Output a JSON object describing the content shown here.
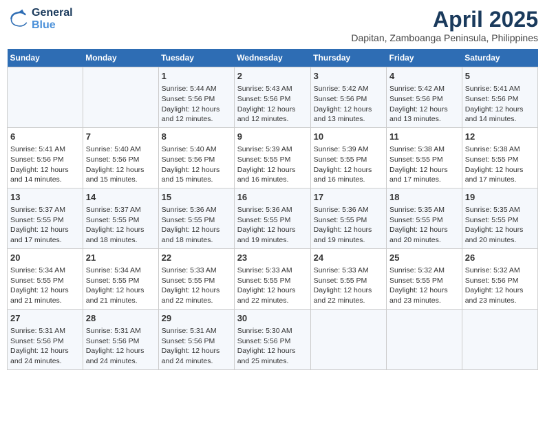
{
  "header": {
    "logo_line1": "General",
    "logo_line2": "Blue",
    "title": "April 2025",
    "subtitle": "Dapitan, Zamboanga Peninsula, Philippines"
  },
  "days_of_week": [
    "Sunday",
    "Monday",
    "Tuesday",
    "Wednesday",
    "Thursday",
    "Friday",
    "Saturday"
  ],
  "weeks": [
    [
      {
        "day": "",
        "content": ""
      },
      {
        "day": "",
        "content": ""
      },
      {
        "day": "1",
        "content": "Sunrise: 5:44 AM\nSunset: 5:56 PM\nDaylight: 12 hours and 12 minutes."
      },
      {
        "day": "2",
        "content": "Sunrise: 5:43 AM\nSunset: 5:56 PM\nDaylight: 12 hours and 12 minutes."
      },
      {
        "day": "3",
        "content": "Sunrise: 5:42 AM\nSunset: 5:56 PM\nDaylight: 12 hours and 13 minutes."
      },
      {
        "day": "4",
        "content": "Sunrise: 5:42 AM\nSunset: 5:56 PM\nDaylight: 12 hours and 13 minutes."
      },
      {
        "day": "5",
        "content": "Sunrise: 5:41 AM\nSunset: 5:56 PM\nDaylight: 12 hours and 14 minutes."
      }
    ],
    [
      {
        "day": "6",
        "content": "Sunrise: 5:41 AM\nSunset: 5:56 PM\nDaylight: 12 hours and 14 minutes."
      },
      {
        "day": "7",
        "content": "Sunrise: 5:40 AM\nSunset: 5:56 PM\nDaylight: 12 hours and 15 minutes."
      },
      {
        "day": "8",
        "content": "Sunrise: 5:40 AM\nSunset: 5:56 PM\nDaylight: 12 hours and 15 minutes."
      },
      {
        "day": "9",
        "content": "Sunrise: 5:39 AM\nSunset: 5:55 PM\nDaylight: 12 hours and 16 minutes."
      },
      {
        "day": "10",
        "content": "Sunrise: 5:39 AM\nSunset: 5:55 PM\nDaylight: 12 hours and 16 minutes."
      },
      {
        "day": "11",
        "content": "Sunrise: 5:38 AM\nSunset: 5:55 PM\nDaylight: 12 hours and 17 minutes."
      },
      {
        "day": "12",
        "content": "Sunrise: 5:38 AM\nSunset: 5:55 PM\nDaylight: 12 hours and 17 minutes."
      }
    ],
    [
      {
        "day": "13",
        "content": "Sunrise: 5:37 AM\nSunset: 5:55 PM\nDaylight: 12 hours and 17 minutes."
      },
      {
        "day": "14",
        "content": "Sunrise: 5:37 AM\nSunset: 5:55 PM\nDaylight: 12 hours and 18 minutes."
      },
      {
        "day": "15",
        "content": "Sunrise: 5:36 AM\nSunset: 5:55 PM\nDaylight: 12 hours and 18 minutes."
      },
      {
        "day": "16",
        "content": "Sunrise: 5:36 AM\nSunset: 5:55 PM\nDaylight: 12 hours and 19 minutes."
      },
      {
        "day": "17",
        "content": "Sunrise: 5:36 AM\nSunset: 5:55 PM\nDaylight: 12 hours and 19 minutes."
      },
      {
        "day": "18",
        "content": "Sunrise: 5:35 AM\nSunset: 5:55 PM\nDaylight: 12 hours and 20 minutes."
      },
      {
        "day": "19",
        "content": "Sunrise: 5:35 AM\nSunset: 5:55 PM\nDaylight: 12 hours and 20 minutes."
      }
    ],
    [
      {
        "day": "20",
        "content": "Sunrise: 5:34 AM\nSunset: 5:55 PM\nDaylight: 12 hours and 21 minutes."
      },
      {
        "day": "21",
        "content": "Sunrise: 5:34 AM\nSunset: 5:55 PM\nDaylight: 12 hours and 21 minutes."
      },
      {
        "day": "22",
        "content": "Sunrise: 5:33 AM\nSunset: 5:55 PM\nDaylight: 12 hours and 22 minutes."
      },
      {
        "day": "23",
        "content": "Sunrise: 5:33 AM\nSunset: 5:55 PM\nDaylight: 12 hours and 22 minutes."
      },
      {
        "day": "24",
        "content": "Sunrise: 5:33 AM\nSunset: 5:55 PM\nDaylight: 12 hours and 22 minutes."
      },
      {
        "day": "25",
        "content": "Sunrise: 5:32 AM\nSunset: 5:55 PM\nDaylight: 12 hours and 23 minutes."
      },
      {
        "day": "26",
        "content": "Sunrise: 5:32 AM\nSunset: 5:56 PM\nDaylight: 12 hours and 23 minutes."
      }
    ],
    [
      {
        "day": "27",
        "content": "Sunrise: 5:31 AM\nSunset: 5:56 PM\nDaylight: 12 hours and 24 minutes."
      },
      {
        "day": "28",
        "content": "Sunrise: 5:31 AM\nSunset: 5:56 PM\nDaylight: 12 hours and 24 minutes."
      },
      {
        "day": "29",
        "content": "Sunrise: 5:31 AM\nSunset: 5:56 PM\nDaylight: 12 hours and 24 minutes."
      },
      {
        "day": "30",
        "content": "Sunrise: 5:30 AM\nSunset: 5:56 PM\nDaylight: 12 hours and 25 minutes."
      },
      {
        "day": "",
        "content": ""
      },
      {
        "day": "",
        "content": ""
      },
      {
        "day": "",
        "content": ""
      }
    ]
  ]
}
